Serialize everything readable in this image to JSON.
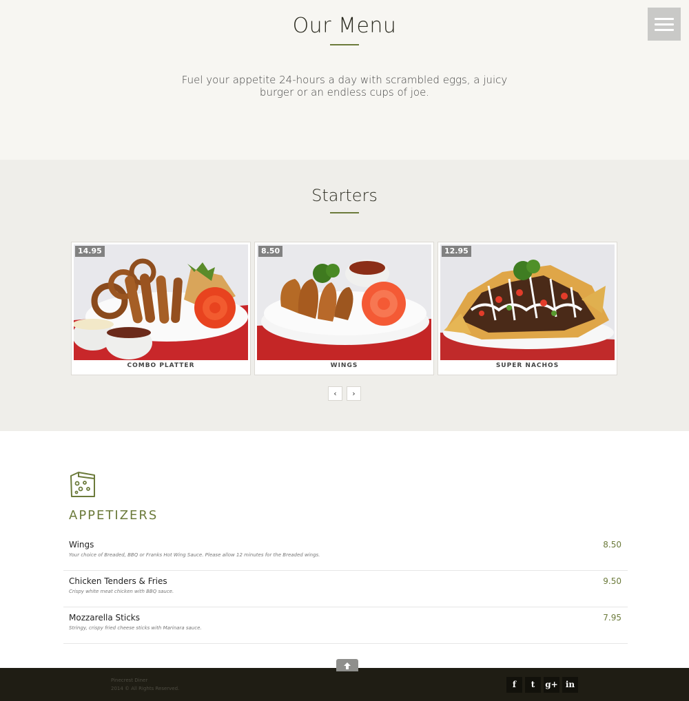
{
  "hero": {
    "title": "Our Menu",
    "intro": "Fuel your appetite 24-hours a day with scrambled eggs, a juicy burger or an endless cups of joe."
  },
  "nav": {
    "menu_icon": "hamburger-menu-icon"
  },
  "starters": {
    "title": "Starters",
    "items": [
      {
        "price": "14.95",
        "name": "COMBO PLATTER"
      },
      {
        "price": "8.50",
        "name": "WINGS"
      },
      {
        "price": "12.95",
        "name": "SUPER NACHOS"
      }
    ],
    "prev_label": "‹",
    "next_label": "›"
  },
  "appetizers": {
    "icon": "cheese-icon",
    "title": "APPETIZERS",
    "items": [
      {
        "name": "Wings",
        "desc": "Your choice of Breaded, BBQ or Franks Hot Wing Sauce. Please allow 12 minutes for the Breaded wings.",
        "price": "8.50"
      },
      {
        "name": "Chicken Tenders & Fries",
        "desc": "Crispy white meat chicken with BBQ sauce.",
        "price": "9.50"
      },
      {
        "name": "Mozzarella Sticks",
        "desc": "Stringy, crispy fried cheese sticks with Marinara sauce.",
        "price": "7.95"
      }
    ]
  },
  "footer": {
    "brand": "Pinecrest Diner",
    "copyright": "2014 © All Rights Reserved.",
    "social": [
      {
        "label": "f",
        "icon": "facebook-icon"
      },
      {
        "label": "t",
        "icon": "twitter-icon"
      },
      {
        "label": "g+",
        "icon": "google-plus-icon"
      },
      {
        "label": "in",
        "icon": "linkedin-icon"
      }
    ]
  },
  "colors": {
    "accent": "#6b7a3a",
    "hero_bg": "#f7f6f2",
    "starters_bg": "#efeeea",
    "footer_bg": "#1f1d14"
  }
}
